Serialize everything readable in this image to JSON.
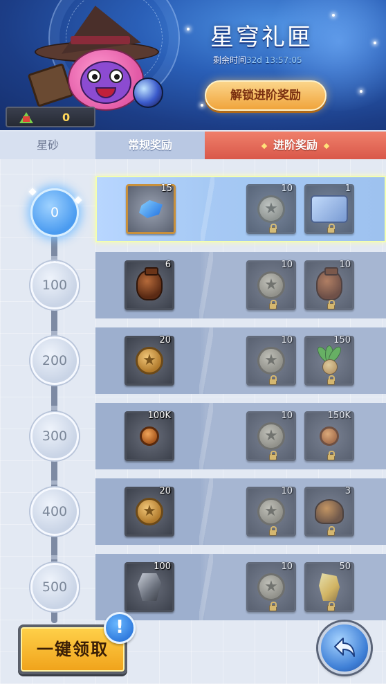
{
  "header": {
    "title": "星穹礼匣",
    "timer_label": "剩余时间",
    "timer_value": "32d 13:57:05",
    "unlock_button": "解锁进阶奖励",
    "currency_amount": "0"
  },
  "tabs": [
    {
      "label": "星砂"
    },
    {
      "label": "常规奖励"
    },
    {
      "label": "进阶奖励"
    }
  ],
  "levels": [
    {
      "value": "0",
      "active": true,
      "normal": {
        "icon": "blue-crystal",
        "qty": "15"
      },
      "advanced": [
        {
          "icon": "star-coin",
          "qty": "10"
        },
        {
          "icon": "star-map",
          "qty": "1"
        }
      ]
    },
    {
      "value": "100",
      "active": false,
      "normal": {
        "icon": "clay-vase",
        "qty": "6"
      },
      "advanced": [
        {
          "icon": "star-coin",
          "qty": "10"
        },
        {
          "icon": "clay-vase",
          "qty": "10"
        }
      ]
    },
    {
      "value": "200",
      "active": false,
      "normal": {
        "icon": "star-coin",
        "qty": "20"
      },
      "advanced": [
        {
          "icon": "star-coin",
          "qty": "10"
        },
        {
          "icon": "plant-bulb",
          "qty": "150"
        }
      ]
    },
    {
      "value": "300",
      "active": false,
      "normal": {
        "icon": "bronze-coin",
        "qty": "100K"
      },
      "advanced": [
        {
          "icon": "star-coin",
          "qty": "10"
        },
        {
          "icon": "bronze-coin",
          "qty": "150K"
        }
      ]
    },
    {
      "value": "400",
      "active": false,
      "normal": {
        "icon": "star-coin",
        "qty": "20"
      },
      "advanced": [
        {
          "icon": "star-coin",
          "qty": "10"
        },
        {
          "icon": "helmet",
          "qty": "3"
        }
      ]
    },
    {
      "value": "500",
      "active": false,
      "normal": {
        "icon": "iron-ore",
        "qty": "100"
      },
      "advanced": [
        {
          "icon": "star-coin",
          "qty": "10"
        },
        {
          "icon": "gold-ore",
          "qty": "50"
        }
      ]
    }
  ],
  "footer": {
    "claim_all_button": "一键领取",
    "alert_badge": "!"
  }
}
